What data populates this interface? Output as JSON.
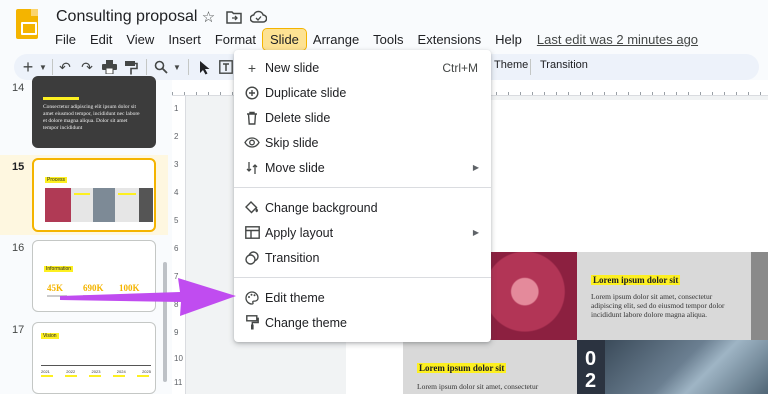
{
  "app": {
    "doc_title": "Consulting proposal",
    "last_edit": "Last edit was 2 minutes ago",
    "menu": [
      "File",
      "Edit",
      "View",
      "Insert",
      "Format",
      "Slide",
      "Arrange",
      "Tools",
      "Extensions",
      "Help"
    ],
    "active_menu": "Slide"
  },
  "toolbar": {
    "theme_label": "Theme",
    "transition_label": "Transition"
  },
  "filmstrip": {
    "slides": [
      {
        "number": "14",
        "body": "Consectetur adipiscing elit ipsum dolor sit amet eiusmod tempor, incididunt nec labore et dolore magna aliqua. Dolor sit amet tempor incididunt"
      },
      {
        "number": "15",
        "title": "Process"
      },
      {
        "number": "16",
        "title": "Information",
        "stats": [
          "45K",
          "690K",
          "100K"
        ]
      },
      {
        "number": "17",
        "title": "Vision",
        "years": [
          "2021",
          "2022",
          "2023",
          "2024",
          "2025"
        ]
      }
    ],
    "selected": "15"
  },
  "slide_menu": {
    "items": [
      {
        "label": "New slide",
        "shortcut": "Ctrl+M",
        "icon": "plus-icon"
      },
      {
        "label": "Duplicate slide",
        "icon": "duplicate-icon"
      },
      {
        "label": "Delete slide",
        "icon": "trash-icon"
      },
      {
        "label": "Skip slide",
        "icon": "eye-icon"
      },
      {
        "label": "Move slide",
        "icon": "move-icon",
        "submenu": true
      },
      {
        "label": "Change background",
        "icon": "paint-bucket-icon"
      },
      {
        "label": "Apply layout",
        "icon": "layout-icon",
        "submenu": true
      },
      {
        "label": "Transition",
        "icon": "transition-icon"
      },
      {
        "label": "Edit theme",
        "icon": "palette-icon"
      },
      {
        "label": "Change theme",
        "icon": "paint-roller-icon"
      }
    ]
  },
  "canvas_slide": {
    "heading_1": "Lorem ipsum dolor sit",
    "body_1": "Lorem ipsum dolor sit amet, consectetur adipiscing elit, sed do eiusmod tempor dolor incididunt labore dolore magna aliqua.",
    "heading_2": "Lorem ipsum dolor sit",
    "body_2": "Lorem ipsum dolor sit amet, consectetur",
    "number": "0 2"
  },
  "colors": {
    "accent": "#f4b400",
    "highlight": "#fdf021",
    "arrow": "#c04cf0"
  }
}
